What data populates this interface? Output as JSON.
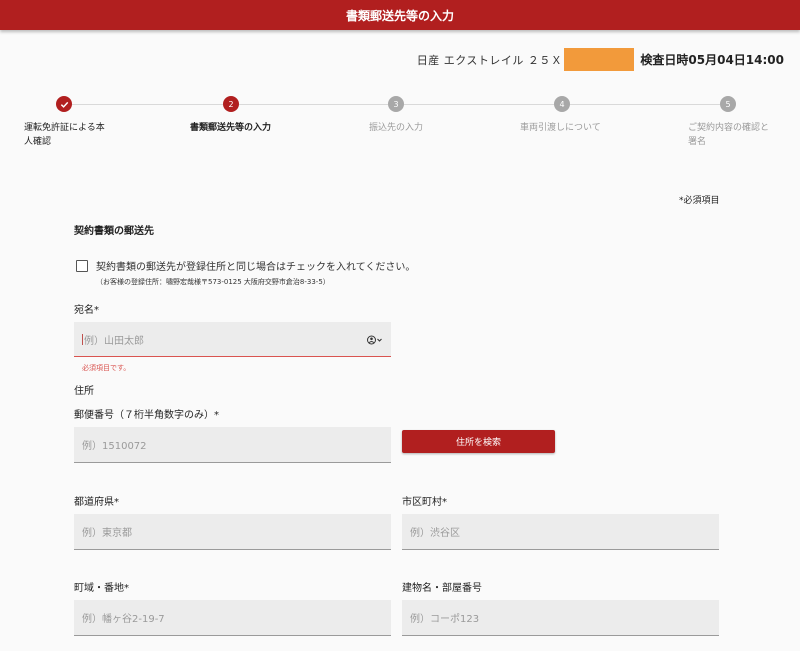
{
  "header": {
    "title": "書類郵送先等の入力"
  },
  "vehicle": {
    "model": "日産 エクストレイル ２５Ｘ",
    "inspection": "検査日時05月04日14:00"
  },
  "stepper": {
    "steps": [
      {
        "number": "✓",
        "label": "運転免許証による本人確認",
        "state": "done"
      },
      {
        "number": "2",
        "label": "書類郵送先等の入力",
        "state": "current"
      },
      {
        "number": "3",
        "label": "振込先の入力",
        "state": "todo"
      },
      {
        "number": "4",
        "label": "車両引渡しについて",
        "state": "todo"
      },
      {
        "number": "5",
        "label": "ご契約内容の確認と署名",
        "state": "todo"
      }
    ]
  },
  "form": {
    "required_note": "*必須項目",
    "section_title": "契約書類の郵送先",
    "same_address_checkbox": "契約書類の郵送先が登録住所と同じ場合はチェックを入れてください。",
    "registered_address_note": "（お客様の登録住所：嘯野宏哉様〒573-0125 大阪府交野市倉治8-33-5）",
    "addressee": {
      "label": "宛名*",
      "placeholder": "例）山田太郎",
      "error": "必須項目です。"
    },
    "address_heading": "住所",
    "postal_code": {
      "label": "郵便番号（７桁半角数字のみ）*",
      "placeholder": "例）1510072"
    },
    "search_button": "住所を検索",
    "prefecture": {
      "label": "都道府県*",
      "placeholder": "例）東京都"
    },
    "city": {
      "label": "市区町村*",
      "placeholder": "例）渋谷区"
    },
    "street": {
      "label": "町域・番地*",
      "placeholder": "例）幡ヶ谷2-19-7"
    },
    "building": {
      "label": "建物名・部屋番号",
      "placeholder": "例）コーポ123"
    }
  },
  "colors": {
    "brand": "#b11f1f",
    "error": "#d9534f",
    "redaction": "#f29a3b"
  }
}
